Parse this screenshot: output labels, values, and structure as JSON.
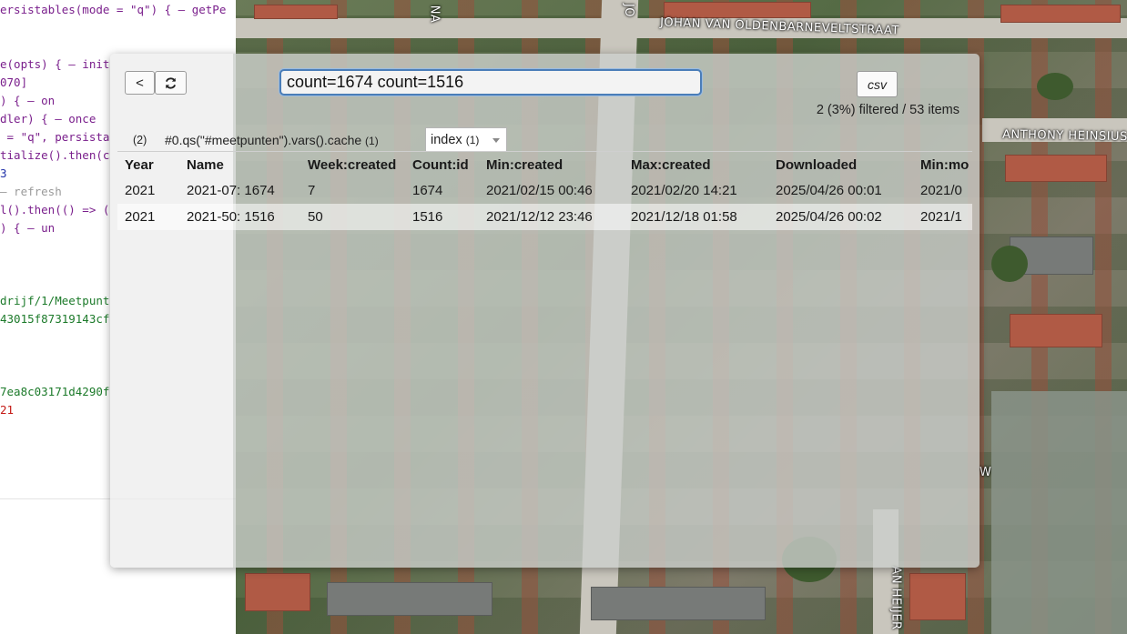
{
  "editor": {
    "lines": [
      {
        "text": "ersistables(mode = \"q\") { – getPe",
        "cls": "c-purple"
      },
      {
        "text": "",
        "cls": "c-dark"
      },
      {
        "text": "",
        "cls": "c-dark"
      },
      {
        "text": "e(opts) { – init",
        "cls": "c-purple"
      },
      {
        "text": "070]",
        "cls": "c-purple"
      },
      {
        "text": ") { – on",
        "cls": "c-purple"
      },
      {
        "text": "dler) { – once",
        "cls": "c-purple"
      },
      {
        "text": " = \"q\", persista",
        "cls": "c-purple"
      },
      {
        "text": "tialize().then(c",
        "cls": "c-purple"
      },
      {
        "text": "3",
        "cls": "c-blue"
      },
      {
        "text": "– refresh",
        "cls": "c-gray"
      },
      {
        "text": "l().then(() => (",
        "cls": "c-purple"
      },
      {
        "text": ") { – un",
        "cls": "c-purple"
      },
      {
        "text": "",
        "cls": "c-dark"
      },
      {
        "text": "",
        "cls": "c-dark"
      },
      {
        "text": "",
        "cls": "c-dark"
      },
      {
        "text": "drijf/1/Meetpunt",
        "cls": "c-green"
      },
      {
        "text": "43015f87319143cf",
        "cls": "c-green"
      },
      {
        "text": "",
        "cls": "c-dark"
      },
      {
        "text": "",
        "cls": "c-dark"
      },
      {
        "text": "",
        "cls": "c-dark"
      },
      {
        "text": "7ea8c03171d4290f",
        "cls": "c-green"
      },
      {
        "text": "21",
        "cls": "c-red"
      }
    ]
  },
  "map": {
    "street_labels": [
      "JOHAN VAN OLDENBARNEVELTSTRAAT",
      "ANTHONY HEINSIUSS",
      "NA",
      "JO",
      "AN HEIJER",
      "W"
    ]
  },
  "panel": {
    "back_label": "<",
    "refresh_icon": "refresh-icon",
    "search_value": "count=1674 count=1516",
    "csv_label": "csv",
    "filter_status": "2 (3%) filtered / 53 items",
    "tab_count": "(2)",
    "tab_path": "#0.qs(\"#meetpunten\").vars().cache",
    "tab_path_count": "(1)",
    "index_label": "index",
    "index_count": "(1)"
  },
  "table": {
    "columns": [
      "Year",
      "Name",
      "Week:created",
      "Count:id",
      "Min:created",
      "Max:created",
      "Downloaded",
      "Min:mo"
    ],
    "rows": [
      [
        "2021",
        "2021-07: 1674",
        "7",
        "1674",
        "2021/02/15 00:46",
        "2021/02/20 14:21",
        "2025/04/26 00:01",
        "2021/0"
      ],
      [
        "2021",
        "2021-50: 1516",
        "50",
        "1516",
        "2021/12/12 23:46",
        "2021/12/18 01:58",
        "2025/04/26 00:02",
        "2021/1"
      ]
    ]
  }
}
